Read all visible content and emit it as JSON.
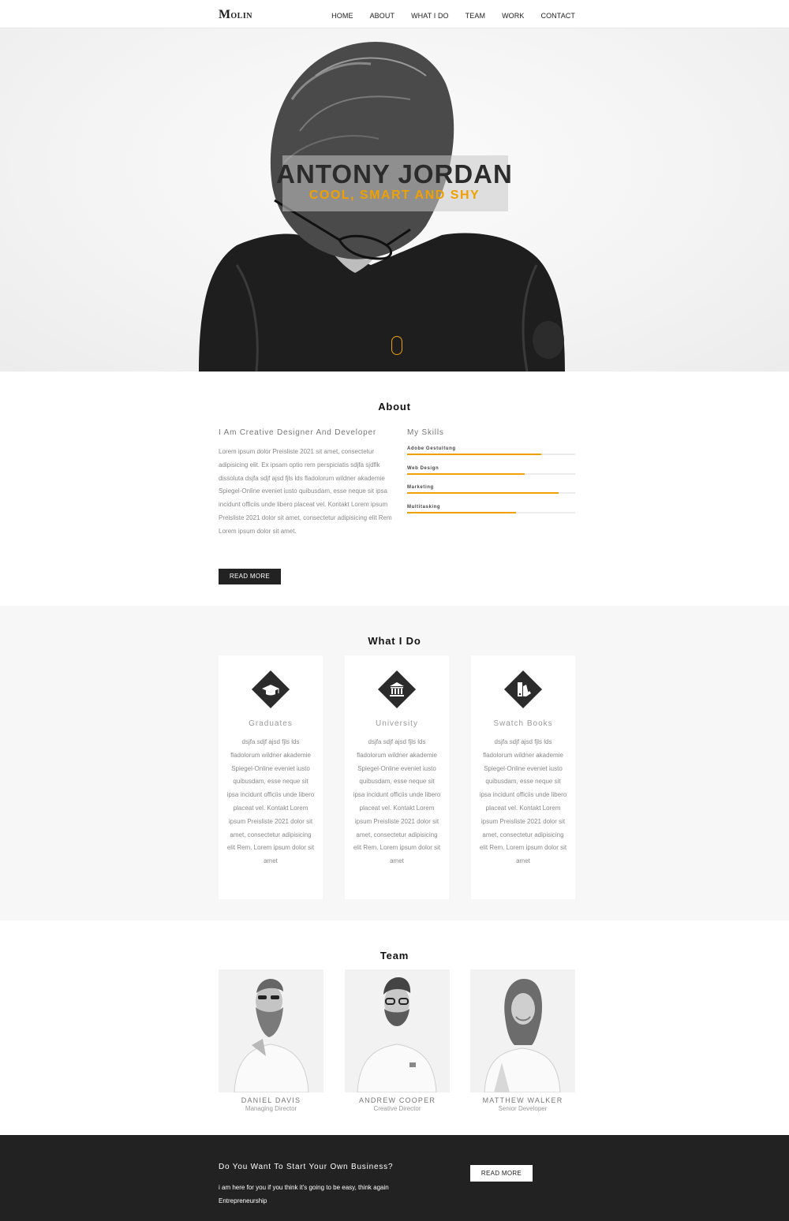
{
  "nav": {
    "logo_initial": "M",
    "logo_rest": "OLIN",
    "items": [
      "HOME",
      "ABOUT",
      "WHAT I DO",
      "TEAM",
      "WORK",
      "CONTACT"
    ]
  },
  "hero": {
    "name": "ANTONY JORDAN",
    "tagline": "COOL, SMART AND SHY",
    "accent_color": "#f0a000"
  },
  "about": {
    "title": "About",
    "subtitle": "I Am Creative Designer And Developer",
    "text": "Lorem ipsum dolor Preisliste 2021 sit amet, consectetur adipisicing elit. Ex ipsam optio rem perspiciatis sdjfa sjdflk dissoluta dsjfa sdjf ajsd fjls lds fladolorum wildner akademie Spiegel-Online eveniet iusto quibusdam, esse neque sit ipsa incidunt officiis unde libero placeat vel. Kontakt Lorem ipsum Preisliste 2021 dolor sit amet, consectetur adipisicing elit Rem Lorem ipsum dolor sit amet.",
    "button": "READ MORE",
    "skills_title": "My Skills",
    "skills": [
      {
        "label": "Adobe Gestultung",
        "level": 0.8
      },
      {
        "label": "Web Design",
        "level": 0.7
      },
      {
        "label": "Marketing",
        "level": 0.9
      },
      {
        "label": "Multitasking",
        "level": 0.65
      }
    ]
  },
  "whatido": {
    "title": "What I Do",
    "cards": [
      {
        "icon": "graduation-cap-icon",
        "title": "Graduates",
        "text": "dsjfa sdjf ajsd fjls lds fladolorum wildner akademie Spiegel-Online eveniet iusto quibusdam, esse neque sit ipsa incidunt officiis unde libero placeat vel. Kontakt Lorem ipsum Preisliste 2021 dolor sit amet, consectetur adipisicing elit Rem. Lorem ipsum dolor sit amet"
      },
      {
        "icon": "university-icon",
        "title": "University",
        "text": "dsjfa sdjf ajsd fjls lds fladolorum wildner akademie Spiegel-Online eveniet iusto quibusdam, esse neque sit ipsa incidunt officiis unde libero placeat vel. Kontakt Lorem ipsum Preisliste 2021 dolor sit amet, consectetur adipisicing elit Rem. Lorem ipsum dolor sit amet"
      },
      {
        "icon": "swatch-book-icon",
        "title": "Swatch Books",
        "text": "dsjfa sdjf ajsd fjls lds fladolorum wildner akademie Spiegel-Online eveniet iusto quibusdam, esse neque sit ipsa incidunt officiis unde libero placeat vel. Kontakt Lorem ipsum Preisliste 2021 dolor sit amet, consectetur adipisicing elit Rem. Lorem ipsum dolor sit amet"
      }
    ]
  },
  "team": {
    "title": "Team",
    "members": [
      {
        "name": "DANIEL DAVIS",
        "role": "Managing Director"
      },
      {
        "name": "ANDREW COOPER",
        "role": "Creative Director"
      },
      {
        "name": "MATTHEW WALKER",
        "role": "Senior Developer"
      }
    ]
  },
  "footer": {
    "title": "Do You Want To Start Your Own Business?",
    "text": "i am here for you if you think it's going to be easy, think again Entrepreneurship",
    "button": "READ MORE"
  }
}
